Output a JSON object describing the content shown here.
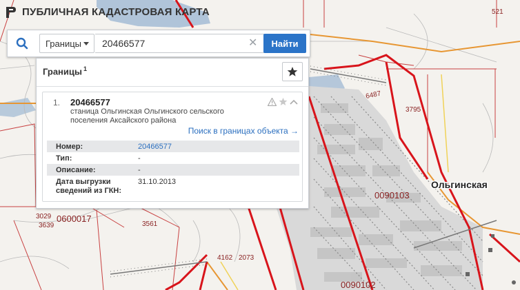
{
  "app": {
    "title": "ПУБЛИЧНАЯ КАДАСТРОВАЯ КАРТА"
  },
  "search": {
    "type_label": "Границы",
    "query": "20466577",
    "find_label": "Найти"
  },
  "results": {
    "title": "Границы",
    "count": "1",
    "item": {
      "index": "1.",
      "cad_number": "20466577",
      "description": "станица Ольгинская Ольгинского сельского поселения Аксайского района",
      "search_link": "Поиск в границах объекта →",
      "attributes": [
        {
          "key": "Номер:",
          "value": "20466577"
        },
        {
          "key": "Тип:",
          "value": "-"
        },
        {
          "key": "Описание:",
          "value": "-"
        },
        {
          "key": "Дата выгрузки сведений из ГКН:",
          "value": "31.10.2013"
        }
      ]
    }
  },
  "map": {
    "labels": {
      "l521": "521",
      "l6487": "6487",
      "l3795": "3795",
      "place": "Ольгинская",
      "q103": "0090103",
      "l3029": "3029",
      "l3639": "3639",
      "q017": "0600017",
      "l3561": "3561",
      "l4162": "4162",
      "l2073": "2073",
      "q102": "0090102"
    },
    "colors": {
      "boundary": "#d8141b",
      "parcel": "#c84040",
      "road": "#e79632",
      "water": "#a9bfd6",
      "settlement": "#d4d4d4"
    }
  }
}
